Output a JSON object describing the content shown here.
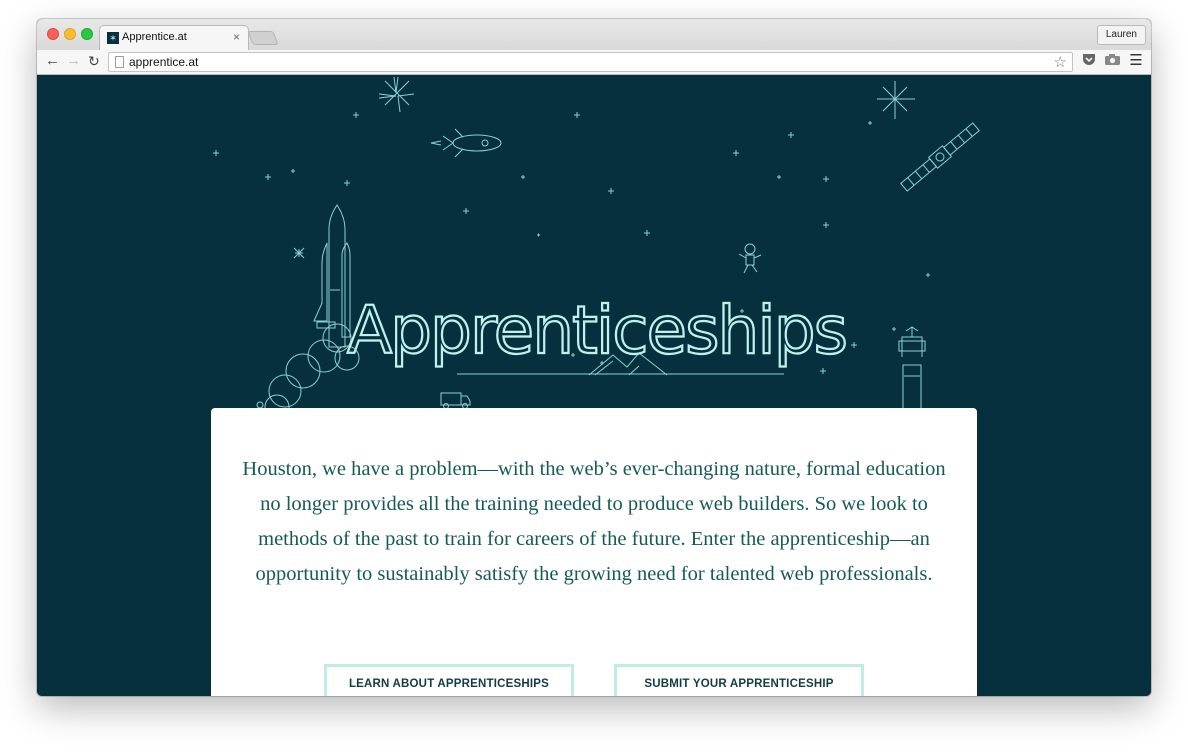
{
  "browser": {
    "tab_title": "Apprentice.at",
    "tab_close": "×",
    "favicon_glyph": "✶",
    "profile_name": "Lauren",
    "url": "apprentice.at",
    "icons": {
      "back": "back-arrow-icon",
      "forward": "forward-arrow-icon",
      "reload": "reload-icon",
      "bookmark": "star-icon",
      "pocket": "pocket-icon",
      "camera": "camera-icon",
      "menu": "hamburger-menu-icon"
    }
  },
  "colors": {
    "page_background": "#07303f",
    "illustration_line": "#9fe3e0",
    "body_text": "#165a55",
    "button_border": "#c3ebe6",
    "button_text": "#123b44"
  },
  "hero": {
    "title": "Apprenticeships"
  },
  "intro": {
    "text": "Houston, we have a problem—with the web’s ever-changing nature, formal education no longer provides all the training needed to produce web builders. So we look to methods of the past to train for careers of the future. Enter the apprenticeship—an opportunity to sustainably satisfy the growing need for talented web professionals."
  },
  "buttons": {
    "learn": "LEARN ABOUT APPRENTICESHIPS",
    "submit": "SUBMIT YOUR APPRENTICESHIP"
  }
}
